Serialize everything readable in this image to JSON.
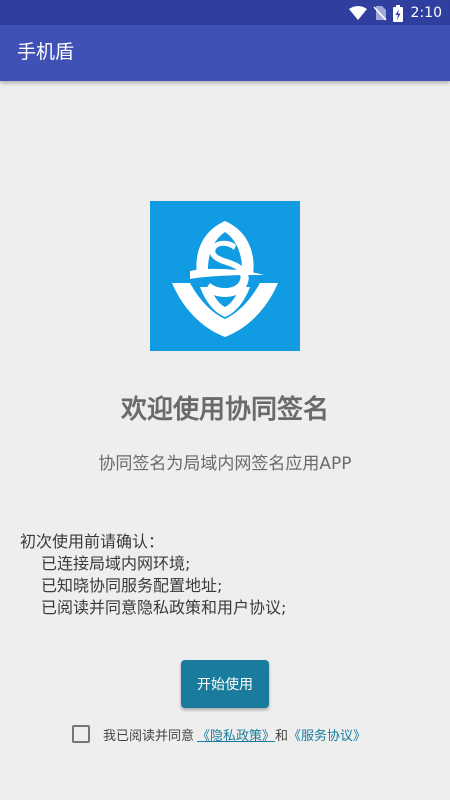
{
  "status_bar": {
    "time": "2:10",
    "icons": [
      "wifi-icon",
      "no-sim-icon",
      "battery-charging-icon"
    ]
  },
  "app_bar": {
    "title": "手机盾"
  },
  "logo": {
    "icon": "shield-s-logo-icon",
    "background_color": "#109be2"
  },
  "welcome": {
    "title": "欢迎使用协同签名",
    "subtitle": "协同签名为局域内网签名应用APP"
  },
  "confirm": {
    "heading": "初次使用前请确认：",
    "items": [
      "已连接局域内网环境;",
      "已知晓协同服务配置地址;",
      "已阅读并同意隐私政策和用户协议;"
    ]
  },
  "start_button": {
    "label": "开始使用",
    "color": "#1a7c9c"
  },
  "agreement": {
    "prefix": "我已阅读并同意",
    "privacy_link": "《隐私政策》",
    "and": "和",
    "service_link": "《服务协议》"
  },
  "colors": {
    "status_bar": "#303f9f",
    "app_bar": "#3f51b5",
    "background": "#eeeeee"
  }
}
